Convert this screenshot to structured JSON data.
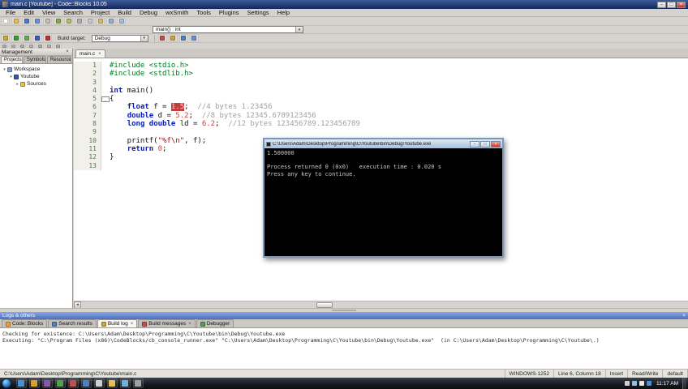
{
  "window": {
    "title": "main.c [Youtube] - Code::Blocks 10.05",
    "minimize": "–",
    "maximize": "□",
    "close": "×"
  },
  "menu": {
    "items": [
      "File",
      "Edit",
      "View",
      "Search",
      "Project",
      "Build",
      "Debug",
      "wxSmith",
      "Tools",
      "Plugins",
      "Settings",
      "Help"
    ]
  },
  "toolbars": {
    "row1": [
      {
        "name": "new-file",
        "color": "#ffffff"
      },
      {
        "name": "open-file",
        "color": "#e8c050"
      },
      {
        "name": "save",
        "color": "#5078c8"
      },
      {
        "name": "save-all",
        "color": "#7090d8"
      },
      {
        "name": "close-file",
        "color": "#c0c0c0"
      },
      {
        "name": "undo",
        "color": "#88a848"
      },
      {
        "name": "redo",
        "color": "#a8c068"
      },
      {
        "name": "cut",
        "color": "#b0b0b8"
      },
      {
        "name": "copy",
        "color": "#c8c8d0"
      },
      {
        "name": "paste",
        "color": "#d8b878"
      },
      {
        "name": "find",
        "color": "#90b0d8"
      },
      {
        "name": "replace",
        "color": "#a0c0e0"
      }
    ],
    "symbol_combo": "main() : int",
    "row3": [
      {
        "name": "build",
        "color": "#c8a830"
      },
      {
        "name": "run",
        "color": "#30a030"
      },
      {
        "name": "build-and-run",
        "color": "#70a858"
      },
      {
        "name": "rebuild",
        "color": "#3060c0"
      },
      {
        "name": "abort-build",
        "color": "#c03030"
      }
    ],
    "build_target_label": "Build target:",
    "build_target_value": "Debug",
    "row3b": [
      {
        "name": "debug-continue",
        "color": "#c05050"
      },
      {
        "name": "run-to-cursor",
        "color": "#d0a040"
      },
      {
        "name": "step-over",
        "color": "#5080c0"
      },
      {
        "name": "step-into",
        "color": "#6890d0"
      }
    ],
    "row4": [
      {
        "name": "symbols-toggle",
        "color": "#b0b0b0"
      },
      {
        "name": "open-files-toggle",
        "color": "#b8b8b8"
      },
      {
        "name": "projects-toggle",
        "color": "#b0b0b0"
      },
      {
        "name": "logs-toggle",
        "color": "#b8b8b8"
      },
      {
        "name": "fullscreen-toggle",
        "color": "#b0b0b0"
      },
      {
        "name": "highlight-mode",
        "color": "#b8b8b8"
      },
      {
        "name": "zoom-code",
        "color": "#b0b0b0"
      }
    ]
  },
  "management": {
    "title": "Management",
    "close_glyph": "×",
    "tabs": [
      {
        "label": "Projects",
        "active": true
      },
      {
        "label": "Symbols",
        "active": false
      },
      {
        "label": "Resources",
        "active": false
      }
    ],
    "tree": [
      {
        "label": "Workspace",
        "level": 0,
        "icon": "workspace-icon",
        "color": "#8a9ad0",
        "twist": "▾"
      },
      {
        "label": "Youtube",
        "level": 1,
        "icon": "project-icon",
        "color": "#3858a8",
        "twist": "▾"
      },
      {
        "label": "Sources",
        "level": 2,
        "icon": "folder-icon",
        "color": "#e0c050",
        "twist": "▸"
      }
    ]
  },
  "editor": {
    "tab": "main.c",
    "tab_close": "×",
    "lines": [
      {
        "n": 1,
        "segs": [
          {
            "t": "#include <stdio.h>",
            "c": "pre"
          }
        ]
      },
      {
        "n": 2,
        "segs": [
          {
            "t": "#include <stdlib.h>",
            "c": "pre"
          }
        ]
      },
      {
        "n": 3,
        "segs": []
      },
      {
        "n": 4,
        "segs": [
          {
            "t": "int",
            "c": "kw"
          },
          {
            "t": " main()",
            "c": "pln"
          }
        ]
      },
      {
        "n": 5,
        "fold": true,
        "segs": [
          {
            "t": "{",
            "c": "pln"
          }
        ]
      },
      {
        "n": 6,
        "segs": [
          {
            "t": "    ",
            "c": "pln"
          },
          {
            "t": "float",
            "c": "kw"
          },
          {
            "t": " f = ",
            "c": "pln"
          },
          {
            "t": "1.5",
            "c": "sel"
          },
          {
            "t": ";  ",
            "c": "pln"
          },
          {
            "t": "//4 bytes 1.23456",
            "c": "cmt"
          }
        ]
      },
      {
        "n": 7,
        "segs": [
          {
            "t": "    ",
            "c": "pln"
          },
          {
            "t": "double",
            "c": "kw"
          },
          {
            "t": " d = ",
            "c": "pln"
          },
          {
            "t": "5.2",
            "c": "num"
          },
          {
            "t": ";  ",
            "c": "pln"
          },
          {
            "t": "//8 bytes 12345.6789123456",
            "c": "cmt"
          }
        ]
      },
      {
        "n": 8,
        "segs": [
          {
            "t": "    ",
            "c": "pln"
          },
          {
            "t": "long double",
            "c": "kw"
          },
          {
            "t": " ld = ",
            "c": "pln"
          },
          {
            "t": "6.2",
            "c": "num"
          },
          {
            "t": ";  ",
            "c": "pln"
          },
          {
            "t": "//12 bytes 123456789.123456789",
            "c": "cmt"
          }
        ]
      },
      {
        "n": 9,
        "segs": []
      },
      {
        "n": 10,
        "segs": [
          {
            "t": "    printf(",
            "c": "pln"
          },
          {
            "t": "\"%f\\n\"",
            "c": "str"
          },
          {
            "t": ", f);",
            "c": "pln"
          }
        ]
      },
      {
        "n": 11,
        "segs": [
          {
            "t": "    ",
            "c": "pln"
          },
          {
            "t": "return",
            "c": "kw"
          },
          {
            "t": " ",
            "c": "pln"
          },
          {
            "t": "0",
            "c": "num"
          },
          {
            "t": ";",
            "c": "pln"
          }
        ]
      },
      {
        "n": 12,
        "segs": [
          {
            "t": "}",
            "c": "pln"
          }
        ]
      },
      {
        "n": 13,
        "segs": []
      }
    ]
  },
  "console": {
    "title": "C:\\Users\\Adam\\Desktop\\Programming\\C\\Youtube\\bin\\Debug\\Youtube.exe",
    "minimize": "–",
    "maximize": "□",
    "close": "×",
    "lines": [
      "1.500000",
      "",
      "Process returned 0 (0x0)   execution time : 0.020 s",
      "Press any key to continue."
    ]
  },
  "logs": {
    "caption": "Logs & others",
    "close_glyph": "×",
    "tabs": [
      {
        "label": "Code::Blocks",
        "active": false,
        "closable": false,
        "color": "#f0a030"
      },
      {
        "label": "Search results",
        "active": false,
        "closable": false,
        "color": "#5080c0"
      },
      {
        "label": "Build log",
        "active": true,
        "closable": true,
        "color": "#c8a830"
      },
      {
        "label": "Build messages",
        "active": false,
        "closable": true,
        "color": "#c05050"
      },
      {
        "label": "Debugger",
        "active": false,
        "closable": false,
        "color": "#50a050"
      }
    ],
    "close_tab_glyph": "×",
    "lines": [
      "Checking for existence: C:\\Users\\Adam\\Desktop\\Programming\\C\\Youtube\\bin\\Debug\\Youtube.exe",
      "Executing: \"C:\\Program Files (x86)\\CodeBlocks/cb_console_runner.exe\" \"C:\\Users\\Adam\\Desktop\\Programming\\C\\Youtube\\bin\\Debug\\Youtube.exe\"  (in C:\\Users\\Adam\\Desktop\\Programming\\C\\Youtube\\.)"
    ]
  },
  "statusbar": {
    "fields": [
      "C:\\Users\\Adam\\Desktop\\Programming\\C\\Youtube\\main.c",
      "WINDOWS-1252",
      "Line 6, Column 18",
      "Insert",
      "Read/Write",
      "default"
    ]
  },
  "taskbar": {
    "clock": "11:17 AM",
    "icons": [
      {
        "name": "taskbar-app-1",
        "color": "#4a90d9"
      },
      {
        "name": "taskbar-app-2",
        "color": "#d8a030"
      },
      {
        "name": "taskbar-app-3",
        "color": "#8858a8"
      },
      {
        "name": "taskbar-app-4",
        "color": "#50a050"
      },
      {
        "name": "taskbar-app-5",
        "color": "#c05050"
      },
      {
        "name": "taskbar-app-6",
        "color": "#5080c0"
      },
      {
        "name": "taskbar-app-7",
        "color": "#d0d0d0"
      },
      {
        "name": "taskbar-app-8",
        "color": "#e0c050"
      },
      {
        "name": "taskbar-app-9",
        "color": "#70b0d8"
      },
      {
        "name": "taskbar-app-10",
        "color": "#a0a0a0"
      }
    ],
    "tray": [
      {
        "name": "tray-icon-1",
        "color": "#d0d0d0"
      },
      {
        "name": "tray-icon-2",
        "color": "#90c0e8"
      },
      {
        "name": "tray-icon-3",
        "color": "#e8e8e8"
      },
      {
        "name": "tray-icon-4",
        "color": "#4a90d9"
      }
    ]
  },
  "glyphs": {
    "combo_arrow": "▾",
    "hs_left": "◂",
    "hs_right": "▸"
  }
}
